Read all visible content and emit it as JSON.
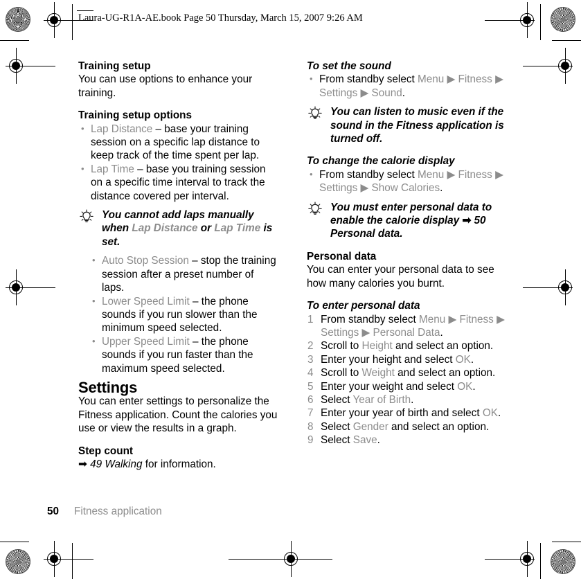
{
  "header": {
    "text": "Laura-UG-R1A-AE.book  Page 50  Thursday, March 15, 2007  9:26 AM"
  },
  "footer": {
    "page_number": "50",
    "chapter": "Fitness application"
  },
  "icons": {
    "tip": "lightbulb-icon",
    "cross_reference": "right-arrow-icon"
  },
  "colors": {
    "text": "#000000",
    "ui_element": "#8c8c8c",
    "background": "#ffffff"
  },
  "left_column": {
    "training_setup": {
      "heading": "Training setup",
      "body": "You can use options to enhance your training."
    },
    "training_setup_options": {
      "heading": "Training setup options",
      "items": [
        {
          "term": "Lap Distance",
          "description": " – base your training session on a specific lap distance to keep track of the time spent per lap."
        },
        {
          "term": "Lap Time",
          "description": " – base you training session on a specific time interval to track the distance covered per interval."
        }
      ],
      "tip": {
        "part1": "You cannot add laps manually when ",
        "ui1": "Lap Distance",
        "part2": " or ",
        "ui2": "Lap Time",
        "part3": " is set."
      },
      "items2": [
        {
          "term": "Auto Stop Session",
          "description": " – stop the training session after a preset number of laps."
        },
        {
          "term": "Lower Speed Limit",
          "description": " – the phone sounds if you run slower than the minimum speed selected."
        },
        {
          "term": "Upper Speed Limit",
          "description": " – the phone sounds if you run faster than the maximum speed selected."
        }
      ]
    },
    "settings": {
      "heading": "Settings",
      "body": "You can enter settings to personalize the Fitness application. Count the calories you use or view the results in a graph."
    },
    "step_count": {
      "heading": "Step count",
      "xref_page": "49 Walking",
      "xref_suffix": " for information."
    }
  },
  "right_column": {
    "to_set_the_sound": {
      "heading": "To set the sound",
      "step_prefix": "From standby select ",
      "path": [
        "Menu",
        "Fitness",
        "Settings",
        "Sound"
      ],
      "step_suffix": "."
    },
    "sound_tip": "You can listen to music even if the sound in the Fitness application is turned off.",
    "to_change_the_calorie_display": {
      "heading": "To change the calorie display",
      "step_prefix": "From standby select ",
      "path": [
        "Menu",
        "Fitness",
        "Settings",
        "Show Calories"
      ],
      "step_suffix": "."
    },
    "calorie_tip": {
      "part1": "You must enter personal data to enable the calorie display ",
      "xref": "50 Personal data",
      "part2": "."
    },
    "personal_data": {
      "heading": "Personal data",
      "body": "You can enter your personal data to see how many calories you burnt."
    },
    "to_enter_personal_data": {
      "heading": "To enter personal data",
      "steps": [
        {
          "prefix": "From standby select ",
          "path": [
            "Menu",
            "Fitness",
            "Settings",
            "Personal Data"
          ],
          "suffix": "."
        },
        {
          "prefix": "Scroll to ",
          "ui": "Height",
          "suffix": " and select an option."
        },
        {
          "prefix": "Enter your height and select ",
          "ui": "OK",
          "suffix": "."
        },
        {
          "prefix": "Scroll to ",
          "ui": "Weight",
          "suffix": " and select an option."
        },
        {
          "prefix": "Enter your weight and select ",
          "ui": "OK",
          "suffix": "."
        },
        {
          "prefix": "Select ",
          "ui": "Year of Birth",
          "suffix": "."
        },
        {
          "prefix": "Enter your year of birth and select ",
          "ui": "OK",
          "suffix": "."
        },
        {
          "prefix": "Select ",
          "ui": "Gender",
          "suffix": " and select an option."
        },
        {
          "prefix": "Select ",
          "ui": "Save",
          "suffix": "."
        }
      ]
    }
  }
}
